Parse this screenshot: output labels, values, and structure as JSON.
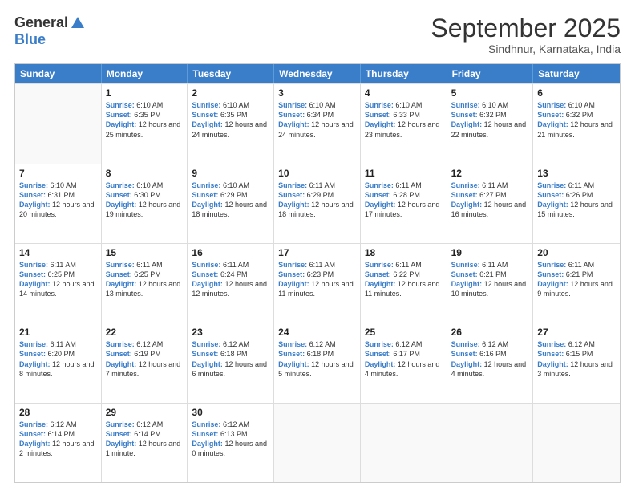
{
  "logo": {
    "general": "General",
    "blue": "Blue"
  },
  "header": {
    "month": "September 2025",
    "location": "Sindhnur, Karnataka, India"
  },
  "days_of_week": [
    "Sunday",
    "Monday",
    "Tuesday",
    "Wednesday",
    "Thursday",
    "Friday",
    "Saturday"
  ],
  "weeks": [
    [
      {
        "day": "",
        "sunrise": "",
        "sunset": "",
        "daylight": ""
      },
      {
        "day": "1",
        "sunrise": "Sunrise: 6:10 AM",
        "sunset": "Sunset: 6:35 PM",
        "daylight": "Daylight: 12 hours and 25 minutes."
      },
      {
        "day": "2",
        "sunrise": "Sunrise: 6:10 AM",
        "sunset": "Sunset: 6:35 PM",
        "daylight": "Daylight: 12 hours and 24 minutes."
      },
      {
        "day": "3",
        "sunrise": "Sunrise: 6:10 AM",
        "sunset": "Sunset: 6:34 PM",
        "daylight": "Daylight: 12 hours and 24 minutes."
      },
      {
        "day": "4",
        "sunrise": "Sunrise: 6:10 AM",
        "sunset": "Sunset: 6:33 PM",
        "daylight": "Daylight: 12 hours and 23 minutes."
      },
      {
        "day": "5",
        "sunrise": "Sunrise: 6:10 AM",
        "sunset": "Sunset: 6:32 PM",
        "daylight": "Daylight: 12 hours and 22 minutes."
      },
      {
        "day": "6",
        "sunrise": "Sunrise: 6:10 AM",
        "sunset": "Sunset: 6:32 PM",
        "daylight": "Daylight: 12 hours and 21 minutes."
      }
    ],
    [
      {
        "day": "7",
        "sunrise": "Sunrise: 6:10 AM",
        "sunset": "Sunset: 6:31 PM",
        "daylight": "Daylight: 12 hours and 20 minutes."
      },
      {
        "day": "8",
        "sunrise": "Sunrise: 6:10 AM",
        "sunset": "Sunset: 6:30 PM",
        "daylight": "Daylight: 12 hours and 19 minutes."
      },
      {
        "day": "9",
        "sunrise": "Sunrise: 6:10 AM",
        "sunset": "Sunset: 6:29 PM",
        "daylight": "Daylight: 12 hours and 18 minutes."
      },
      {
        "day": "10",
        "sunrise": "Sunrise: 6:11 AM",
        "sunset": "Sunset: 6:29 PM",
        "daylight": "Daylight: 12 hours and 18 minutes."
      },
      {
        "day": "11",
        "sunrise": "Sunrise: 6:11 AM",
        "sunset": "Sunset: 6:28 PM",
        "daylight": "Daylight: 12 hours and 17 minutes."
      },
      {
        "day": "12",
        "sunrise": "Sunrise: 6:11 AM",
        "sunset": "Sunset: 6:27 PM",
        "daylight": "Daylight: 12 hours and 16 minutes."
      },
      {
        "day": "13",
        "sunrise": "Sunrise: 6:11 AM",
        "sunset": "Sunset: 6:26 PM",
        "daylight": "Daylight: 12 hours and 15 minutes."
      }
    ],
    [
      {
        "day": "14",
        "sunrise": "Sunrise: 6:11 AM",
        "sunset": "Sunset: 6:25 PM",
        "daylight": "Daylight: 12 hours and 14 minutes."
      },
      {
        "day": "15",
        "sunrise": "Sunrise: 6:11 AM",
        "sunset": "Sunset: 6:25 PM",
        "daylight": "Daylight: 12 hours and 13 minutes."
      },
      {
        "day": "16",
        "sunrise": "Sunrise: 6:11 AM",
        "sunset": "Sunset: 6:24 PM",
        "daylight": "Daylight: 12 hours and 12 minutes."
      },
      {
        "day": "17",
        "sunrise": "Sunrise: 6:11 AM",
        "sunset": "Sunset: 6:23 PM",
        "daylight": "Daylight: 12 hours and 11 minutes."
      },
      {
        "day": "18",
        "sunrise": "Sunrise: 6:11 AM",
        "sunset": "Sunset: 6:22 PM",
        "daylight": "Daylight: 12 hours and 11 minutes."
      },
      {
        "day": "19",
        "sunrise": "Sunrise: 6:11 AM",
        "sunset": "Sunset: 6:21 PM",
        "daylight": "Daylight: 12 hours and 10 minutes."
      },
      {
        "day": "20",
        "sunrise": "Sunrise: 6:11 AM",
        "sunset": "Sunset: 6:21 PM",
        "daylight": "Daylight: 12 hours and 9 minutes."
      }
    ],
    [
      {
        "day": "21",
        "sunrise": "Sunrise: 6:11 AM",
        "sunset": "Sunset: 6:20 PM",
        "daylight": "Daylight: 12 hours and 8 minutes."
      },
      {
        "day": "22",
        "sunrise": "Sunrise: 6:12 AM",
        "sunset": "Sunset: 6:19 PM",
        "daylight": "Daylight: 12 hours and 7 minutes."
      },
      {
        "day": "23",
        "sunrise": "Sunrise: 6:12 AM",
        "sunset": "Sunset: 6:18 PM",
        "daylight": "Daylight: 12 hours and 6 minutes."
      },
      {
        "day": "24",
        "sunrise": "Sunrise: 6:12 AM",
        "sunset": "Sunset: 6:18 PM",
        "daylight": "Daylight: 12 hours and 5 minutes."
      },
      {
        "day": "25",
        "sunrise": "Sunrise: 6:12 AM",
        "sunset": "Sunset: 6:17 PM",
        "daylight": "Daylight: 12 hours and 4 minutes."
      },
      {
        "day": "26",
        "sunrise": "Sunrise: 6:12 AM",
        "sunset": "Sunset: 6:16 PM",
        "daylight": "Daylight: 12 hours and 4 minutes."
      },
      {
        "day": "27",
        "sunrise": "Sunrise: 6:12 AM",
        "sunset": "Sunset: 6:15 PM",
        "daylight": "Daylight: 12 hours and 3 minutes."
      }
    ],
    [
      {
        "day": "28",
        "sunrise": "Sunrise: 6:12 AM",
        "sunset": "Sunset: 6:14 PM",
        "daylight": "Daylight: 12 hours and 2 minutes."
      },
      {
        "day": "29",
        "sunrise": "Sunrise: 6:12 AM",
        "sunset": "Sunset: 6:14 PM",
        "daylight": "Daylight: 12 hours and 1 minute."
      },
      {
        "day": "30",
        "sunrise": "Sunrise: 6:12 AM",
        "sunset": "Sunset: 6:13 PM",
        "daylight": "Daylight: 12 hours and 0 minutes."
      },
      {
        "day": "",
        "sunrise": "",
        "sunset": "",
        "daylight": ""
      },
      {
        "day": "",
        "sunrise": "",
        "sunset": "",
        "daylight": ""
      },
      {
        "day": "",
        "sunrise": "",
        "sunset": "",
        "daylight": ""
      },
      {
        "day": "",
        "sunrise": "",
        "sunset": "",
        "daylight": ""
      }
    ]
  ]
}
